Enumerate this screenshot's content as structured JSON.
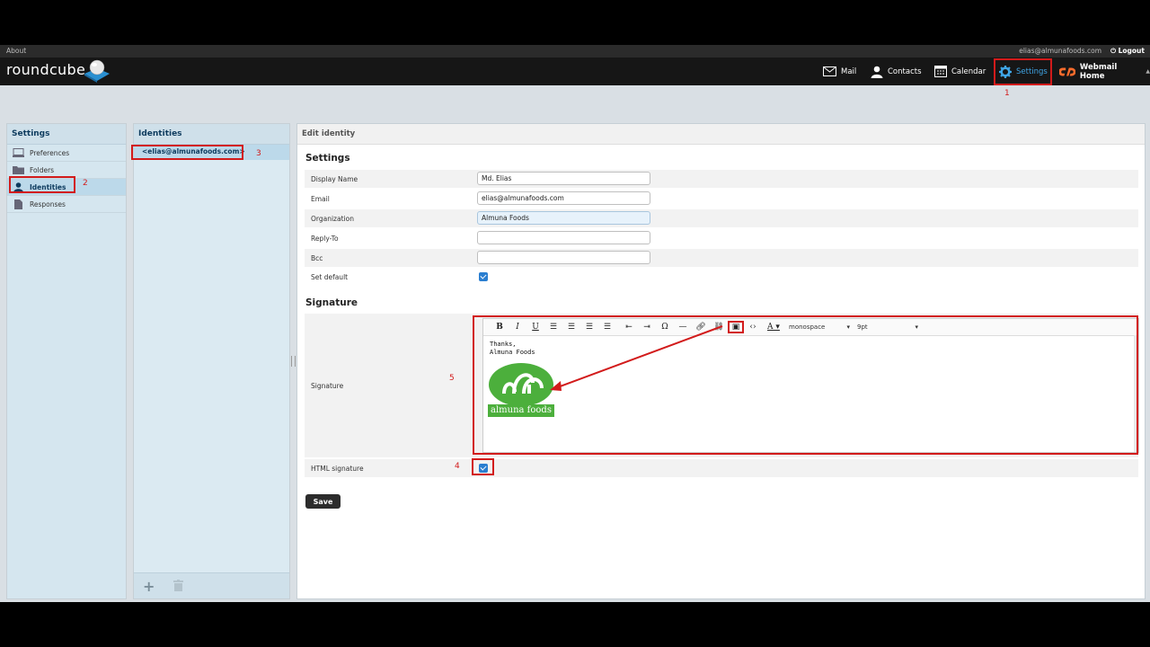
{
  "topbar": {
    "about": "About",
    "user_email": "elias@almunafoods.com",
    "logout": "Logout"
  },
  "header": {
    "logo": "roundcube",
    "nav": {
      "mail": "Mail",
      "contacts": "Contacts",
      "calendar": "Calendar",
      "settings": "Settings",
      "webmail_home": "Webmail Home"
    }
  },
  "settings_panel": {
    "title": "Settings",
    "items": [
      {
        "label": "Preferences"
      },
      {
        "label": "Folders"
      },
      {
        "label": "Identities",
        "selected": true
      },
      {
        "label": "Responses"
      }
    ]
  },
  "identities_panel": {
    "title": "Identities",
    "items": [
      {
        "label": "<elias@almunafoods.com>"
      }
    ]
  },
  "edit": {
    "header": "Edit identity",
    "settings_title": "Settings",
    "fields": {
      "display_name": {
        "label": "Display Name",
        "value": "Md. Elias"
      },
      "email": {
        "label": "Email",
        "value": "elias@almunafoods.com"
      },
      "organization": {
        "label": "Organization",
        "value": "Almuna Foods"
      },
      "reply_to": {
        "label": "Reply-To",
        "value": ""
      },
      "bcc": {
        "label": "Bcc",
        "value": ""
      },
      "set_default": {
        "label": "Set default",
        "checked": true
      }
    },
    "signature_title": "Signature",
    "signature_label": "Signature",
    "signature_text": "Thanks,\nAlmuna Foods",
    "logo_text": "almuna foods",
    "toolbar": {
      "font": "monospace",
      "size": "9pt"
    },
    "html_signature": {
      "label": "HTML signature",
      "checked": true
    },
    "save": "Save"
  },
  "annotations": {
    "n1": "1",
    "n2": "2",
    "n3": "3",
    "n4": "4",
    "n5": "5"
  },
  "colors": {
    "accent": "#3fa5e6",
    "annotation": "#d21b1b",
    "logo_green": "#4caf3c"
  }
}
